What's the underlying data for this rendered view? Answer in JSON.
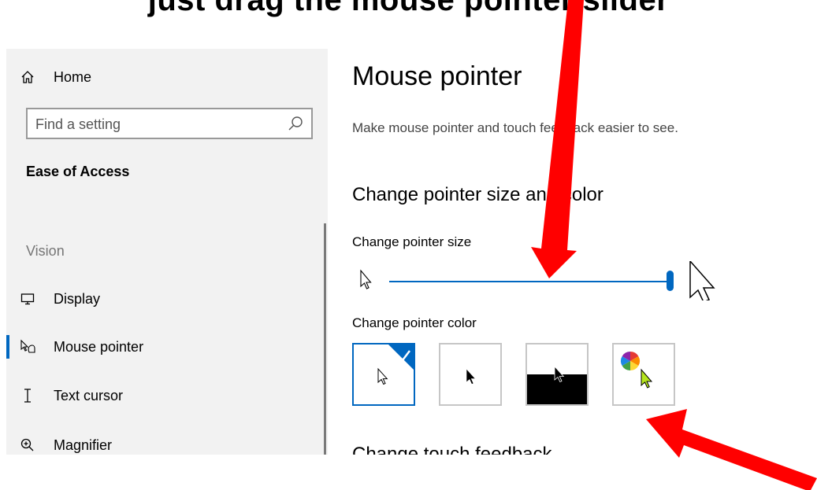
{
  "annotation": {
    "top_text": "just drag the mouse pointer slider"
  },
  "sidebar": {
    "home_label": "Home",
    "search": {
      "placeholder": "Find a setting"
    },
    "section_title": "Ease of Access",
    "group_label": "Vision",
    "items": [
      {
        "label": "Display",
        "icon": "monitor-icon"
      },
      {
        "label": "Mouse pointer",
        "icon": "mouse-pointer-icon",
        "active": true
      },
      {
        "label": "Text cursor",
        "icon": "text-cursor-icon"
      },
      {
        "label": "Magnifier",
        "icon": "magnifier-icon"
      }
    ]
  },
  "main": {
    "title": "Mouse pointer",
    "description": "Make mouse pointer and touch feedback easier to see.",
    "section_title": "Change pointer size and color",
    "size_label": "Change pointer size",
    "size_value": 1.0,
    "color_label": "Change pointer color",
    "color_options": [
      {
        "name": "white",
        "selected": true
      },
      {
        "name": "black",
        "selected": false
      },
      {
        "name": "inverted",
        "selected": false
      },
      {
        "name": "custom",
        "selected": false
      }
    ],
    "next_section_title": "Change touch feedback"
  },
  "colors": {
    "accent": "#0067c0",
    "arrow": "#ff0000",
    "sidebar_bg": "#f2f2f2"
  }
}
